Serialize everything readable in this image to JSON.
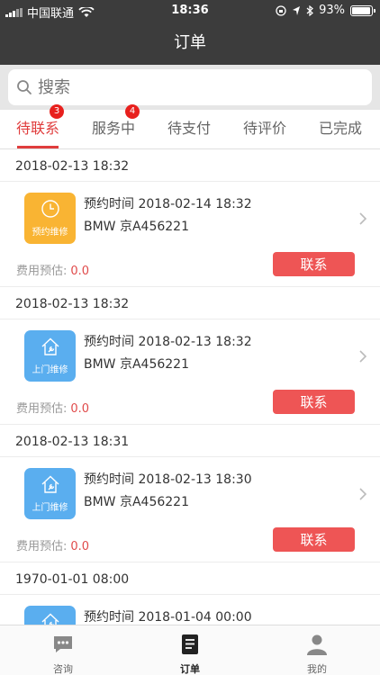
{
  "status_bar": {
    "carrier": "中国联通",
    "time": "18:36",
    "battery": "93%",
    "battery_level": 0.93
  },
  "nav": {
    "title": "订单"
  },
  "search": {
    "placeholder": "搜索"
  },
  "tabs": [
    {
      "label": "待联系",
      "badge": "3",
      "active": true
    },
    {
      "label": "服务中",
      "badge": "4",
      "active": false
    },
    {
      "label": "待支付",
      "badge": "",
      "active": false
    },
    {
      "label": "待评价",
      "badge": "",
      "active": false
    },
    {
      "label": "已完成",
      "badge": "",
      "active": false
    }
  ],
  "colors": {
    "accent": "#e03d3d",
    "header": "#3c3c3c",
    "icon_orange": "#f9b433",
    "icon_blue": "#5aaeef",
    "button": "#ee5555"
  },
  "orders": [
    {
      "date": "2018-02-13 18:32",
      "service_type": "预约维修",
      "icon": "clock-icon",
      "icon_color": "#f9b433",
      "appointment": "预约时间 2018-02-14 18:32",
      "car": "BMW 京A456221",
      "fee_label": "费用预估:",
      "fee": "0.0",
      "button": "联系"
    },
    {
      "date": "2018-02-13 18:32",
      "service_type": "上门维修",
      "icon": "house-wrench-icon",
      "icon_color": "#5aaeef",
      "appointment": "预约时间 2018-02-13 18:32",
      "car": "BMW 京A456221",
      "fee_label": "费用预估:",
      "fee": "0.0",
      "button": "联系"
    },
    {
      "date": "2018-02-13 18:31",
      "service_type": "上门维修",
      "icon": "house-wrench-icon",
      "icon_color": "#5aaeef",
      "appointment": "预约时间 2018-02-13 18:30",
      "car": "BMW 京A456221",
      "fee_label": "费用预估:",
      "fee": "0.0",
      "button": "联系"
    },
    {
      "date": "1970-01-01 08:00",
      "service_type": "上门维修",
      "icon": "house-wrench-icon",
      "icon_color": "#5aaeef",
      "appointment": "预约时间 2018-01-04 00:00",
      "car": "",
      "fee_label": "",
      "fee": "",
      "button": ""
    }
  ],
  "tabbar": [
    {
      "label": "咨询",
      "icon": "chat-icon",
      "active": false
    },
    {
      "label": "订单",
      "icon": "orders-icon",
      "active": true
    },
    {
      "label": "我的",
      "icon": "profile-icon",
      "active": false
    }
  ]
}
